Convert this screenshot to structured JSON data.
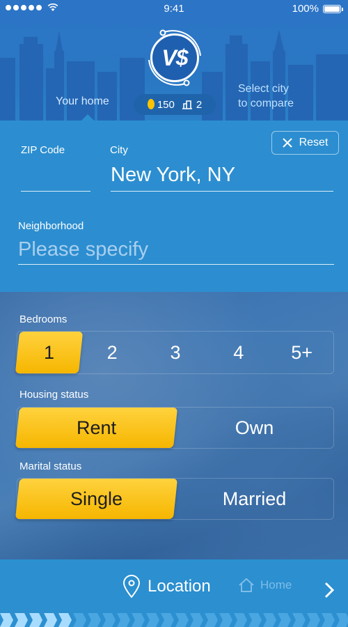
{
  "status_bar": {
    "time": "9:41",
    "battery": "100%",
    "signal_bars": 5
  },
  "header": {
    "logo_text": "V$",
    "your_home_label": "Your home",
    "compare_line1": "Select city",
    "compare_line2": "to compare",
    "coins": "150",
    "buildings": "2"
  },
  "form": {
    "zip_label": "ZIP Code",
    "zip_value": "",
    "city_label": "City",
    "city_value": "New York, NY",
    "reset_label": "Reset",
    "neighborhood_label": "Neighborhood",
    "neighborhood_placeholder": "Please specify"
  },
  "bedrooms": {
    "label": "Bedrooms",
    "options": [
      "1",
      "2",
      "3",
      "4",
      "5+"
    ],
    "selected": "1"
  },
  "housing_status": {
    "label": "Housing status",
    "options": [
      "Rent",
      "Own"
    ],
    "selected": "Rent"
  },
  "marital_status": {
    "label": "Marital status",
    "options": [
      "Single",
      "Married"
    ],
    "selected": "Single"
  },
  "bottom_nav": {
    "current_label": "Location",
    "next_label": "Home",
    "progress_fraction": 0.2
  },
  "colors": {
    "header_bg": "#2a78c4",
    "panel_bg": "#2c8ed0",
    "accent_yellow": "#ffc72c",
    "muted_text": "#7fbde8"
  },
  "icons": [
    "wifi-icon",
    "battery-icon",
    "coin-icon",
    "building-icon",
    "close-icon",
    "location-pin-icon",
    "home-icon",
    "chevron-right-icon"
  ]
}
